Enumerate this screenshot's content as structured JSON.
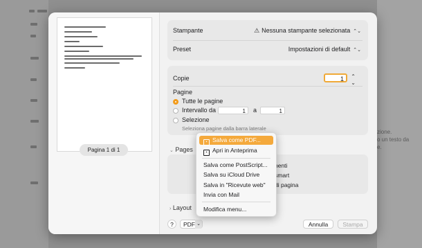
{
  "background": {
    "right_text_1": "zione.",
    "right_text_2": "o un testo da",
    "right_text_3": "e."
  },
  "preview": {
    "page_badge": "Pagina 1 di 1"
  },
  "printer": {
    "label": "Stampante",
    "value": "Nessuna stampante selezionata",
    "icon": "warning-icon"
  },
  "preset": {
    "label": "Preset",
    "value": "Impostazioni di default"
  },
  "copies": {
    "label": "Copie",
    "value": "1"
  },
  "pages": {
    "label": "Pagine",
    "all": "Tutte le pagine",
    "range": "Intervallo da",
    "range_from": "1",
    "range_to_label": "a",
    "range_to": "1",
    "selection": "Selezione",
    "selection_hint": "Seleziona pagine dalla barra laterale"
  },
  "sections": {
    "pages_section": "Pages",
    "layout_section": "Layout",
    "hidden_right_1": "nenti",
    "hidden_right_2": "smart",
    "hidden_right_3": "di pagina"
  },
  "pdf_menu": {
    "items": [
      {
        "label": "Salva come PDF...",
        "highlighted": true,
        "icon": "pdf-icon"
      },
      {
        "label": "Apri in Anteprima",
        "icon": "preview-icon"
      },
      {
        "label": "Salva come PostScript..."
      },
      {
        "label": "Salva su iCloud Drive"
      },
      {
        "label": "Salva in \"Ricevute web\""
      },
      {
        "label": "Invia con Mail"
      },
      {
        "label": "Modifica menu..."
      }
    ]
  },
  "footer": {
    "help": "?",
    "pdf": "PDF",
    "cancel": "Annulla",
    "print": "Stampa"
  },
  "colors": {
    "accent": "#f29b1a",
    "menu_highlight": "#f4a93c"
  }
}
